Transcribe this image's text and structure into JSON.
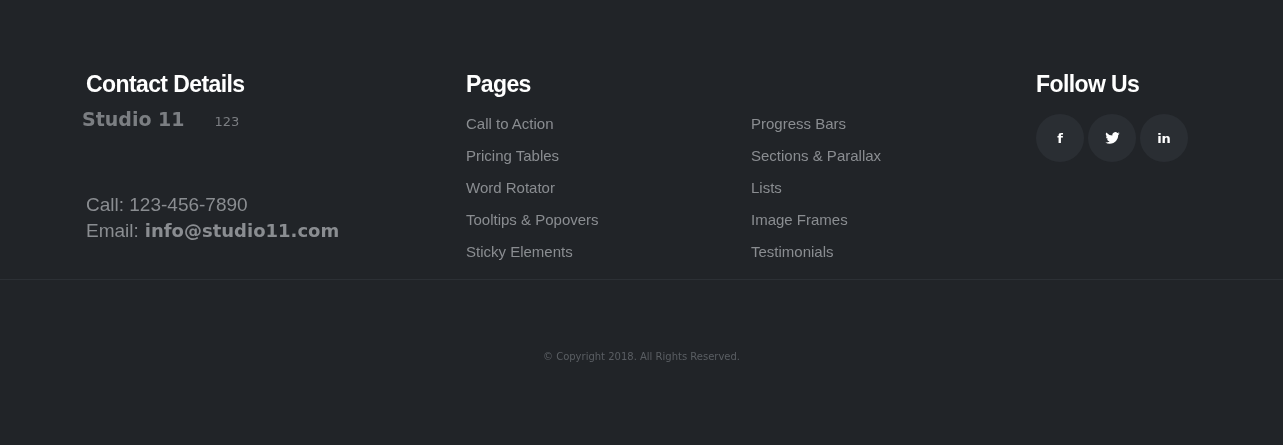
{
  "contact": {
    "heading": "Contact Details",
    "logo": "Studio 11",
    "logo_note": "123",
    "phone": "Call: 123-456-7890",
    "email_label": "Email:",
    "email": "info@studio11.com"
  },
  "pages": {
    "heading": "Pages",
    "columns": [
      [
        "Call to Action",
        "Pricing Tables",
        "Word Rotator",
        "Tooltips & Popovers",
        "Sticky Elements"
      ],
      [
        "Progress Bars",
        "Sections & Parallax",
        "Lists",
        "Image Frames",
        "Testimonials"
      ]
    ]
  },
  "follow": {
    "heading": "Follow Us",
    "links": [
      {
        "kind": "text",
        "label": "f"
      },
      {
        "kind": "bird"
      },
      {
        "kind": "text",
        "label": "in"
      }
    ]
  },
  "copyright": "© Copyright 2018. All Rights Reserved."
}
